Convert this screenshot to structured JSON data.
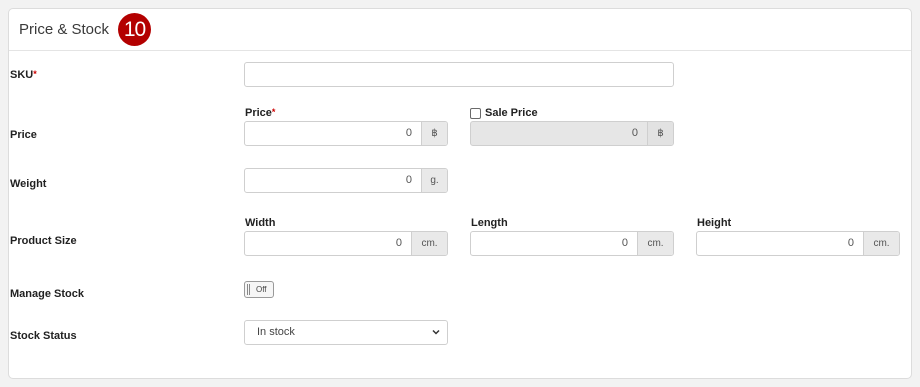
{
  "section": {
    "title": "Price & Stock",
    "step_number": "10"
  },
  "fields": {
    "sku": {
      "label": "SKU",
      "required_mark": "*",
      "value": ""
    },
    "price": {
      "row_label": "Price",
      "price_label": "Price",
      "price_required_mark": "*",
      "price_value": "0",
      "price_unit": "฿",
      "sale_label": "Sale Price",
      "sale_checked": false,
      "sale_value": "0",
      "sale_unit": "฿"
    },
    "weight": {
      "label": "Weight",
      "value": "0",
      "unit": "g."
    },
    "product_size": {
      "label": "Product Size",
      "width_label": "Width",
      "width_value": "0",
      "width_unit": "cm.",
      "length_label": "Length",
      "length_value": "0",
      "length_unit": "cm.",
      "height_label": "Height",
      "height_value": "0",
      "height_unit": "cm."
    },
    "manage_stock": {
      "label": "Manage Stock",
      "toggle_text": "Off"
    },
    "stock_status": {
      "label": "Stock Status",
      "selected": "In stock"
    }
  },
  "colors": {
    "badge": "#b30000",
    "required": "#cc0000",
    "addon_bg": "#e9e9e9",
    "disabled_bg": "#e6e6e6"
  },
  "icons": {
    "select_arrow": "chevron-down-icon"
  }
}
